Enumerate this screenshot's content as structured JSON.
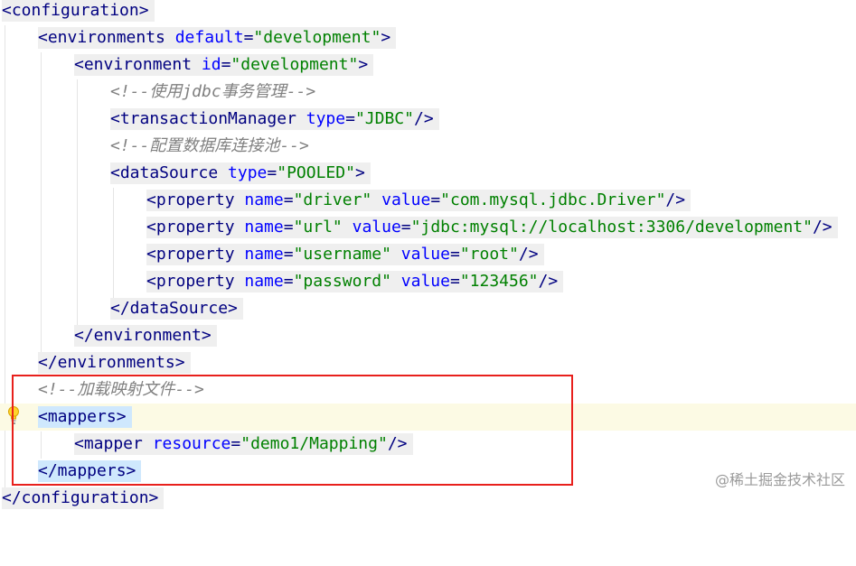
{
  "editor": {
    "language": "XML",
    "lines": [
      [
        "<configuration>"
      ],
      [
        "<environments ",
        "default",
        "=",
        "\"development\"",
        ">"
      ],
      [
        "<environment ",
        "id",
        "=",
        "\"development\"",
        ">"
      ],
      [
        "<!--使用jdbc事务管理-->"
      ],
      [
        "<transactionManager ",
        "type",
        "=",
        "\"JDBC\"",
        "/>"
      ],
      [
        "<!--配置数据库连接池-->"
      ],
      [
        "<dataSource ",
        "type",
        "=",
        "\"POOLED\"",
        ">"
      ],
      [
        "<property ",
        "name",
        "=",
        "\"driver\"",
        " ",
        "value",
        "=",
        "\"com.mysql.jdbc.Driver\"",
        "/>"
      ],
      [
        "<property ",
        "name",
        "=",
        "\"url\"",
        " ",
        "value",
        "=",
        "\"jdbc:mysql://localhost:3306/development\"",
        "/>"
      ],
      [
        "<property ",
        "name",
        "=",
        "\"username\"",
        " ",
        "value",
        "=",
        "\"root\"",
        "/>"
      ],
      [
        "<property ",
        "name",
        "=",
        "\"password\"",
        " ",
        "value",
        "=",
        "\"123456\"",
        "/>"
      ],
      [
        "</dataSource>"
      ],
      [
        "</environment>"
      ],
      [
        "</environments>"
      ],
      [
        "<!--加载映射文件-->"
      ],
      [
        "<mappers>"
      ],
      [
        "<mapper ",
        "resource",
        "=",
        "\"demo1/Mapping\"",
        "/>"
      ],
      [
        "</mappers>"
      ],
      [
        "</configuration>"
      ]
    ]
  },
  "gutter": {
    "intention_icon": "lightbulb-icon"
  },
  "highlight_color": "#e8201c",
  "watermark": "@稀土掘金技术社区"
}
